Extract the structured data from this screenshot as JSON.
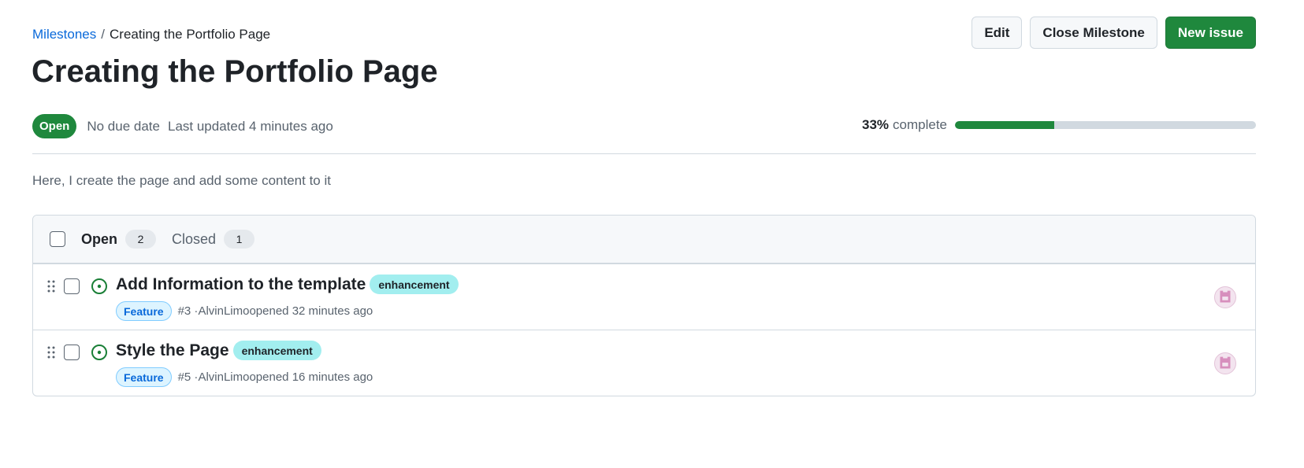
{
  "breadcrumb": {
    "parent": "Milestones",
    "separator": "/",
    "current": "Creating the Portfolio Page"
  },
  "milestone": {
    "title": "Creating the Portfolio Page",
    "state": "Open",
    "due": "No due date",
    "updated": "Last updated 4 minutes ago",
    "progress_percent": 33,
    "progress_label": "33%",
    "progress_suffix": "complete",
    "description": "Here, I create the page and add some content to it"
  },
  "actions": {
    "edit": "Edit",
    "close": "Close Milestone",
    "new_issue": "New issue"
  },
  "issue_tabs": [
    {
      "label": "Open",
      "count": "2"
    },
    {
      "label": "Closed",
      "count": "1"
    }
  ],
  "issues": [
    {
      "title": "Add Information to the template",
      "label": "enhancement",
      "type": "Feature",
      "meta_prefix": "#3 · ",
      "author": "AlvinLimo",
      "meta_suffix": " opened 32 minutes ago"
    },
    {
      "title": "Style the Page",
      "label": "enhancement",
      "type": "Feature",
      "meta_prefix": "#5 · ",
      "author": "AlvinLimo",
      "meta_suffix": " opened 16 minutes ago"
    }
  ],
  "colors": {
    "accent_green": "#1f883d",
    "link_blue": "#0969da",
    "label_enhancement": "#a2eeef"
  },
  "icons": [
    "drag-handle-icon",
    "issue-opened-icon",
    "avatar-icon"
  ]
}
